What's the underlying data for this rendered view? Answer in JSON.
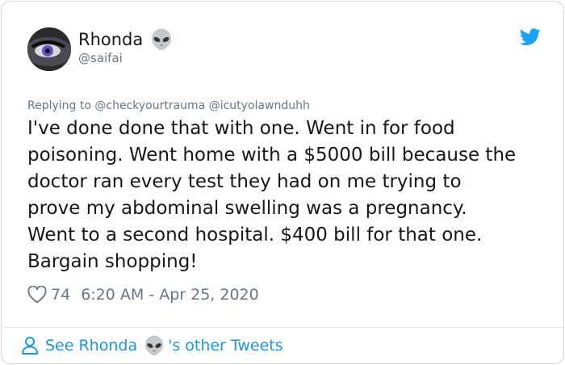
{
  "author": {
    "display_name": "Rhonda",
    "handle": "@saifai",
    "name_emoji": "alien-icon"
  },
  "reply": {
    "prefix": "Replying to",
    "mentions": "@checkyourtrauma @icutyolawnduhh"
  },
  "tweet": {
    "lines": [
      "I've done done that with one. Went in for food",
      "poisoning. Went home with a $5000 bill because the",
      "doctor ran every test they had on me trying to",
      "prove my abdominal swelling was a pregnancy.",
      "Went to a second hospital. $400 bill for that one.",
      "Bargain shopping!"
    ]
  },
  "meta": {
    "likes": "74",
    "timestamp": "6:20 AM - Apr 25, 2020"
  },
  "footer": {
    "prefix": "See Rhonda",
    "suffix": "'s other Tweets"
  },
  "colors": {
    "link_blue": "#1b95e0",
    "twitter_blue": "#1da1f2",
    "secondary_text": "#657786",
    "primary_text": "#14171a"
  },
  "icons": [
    "twitter-bird-icon",
    "alien-icon",
    "heart-icon",
    "person-icon"
  ]
}
